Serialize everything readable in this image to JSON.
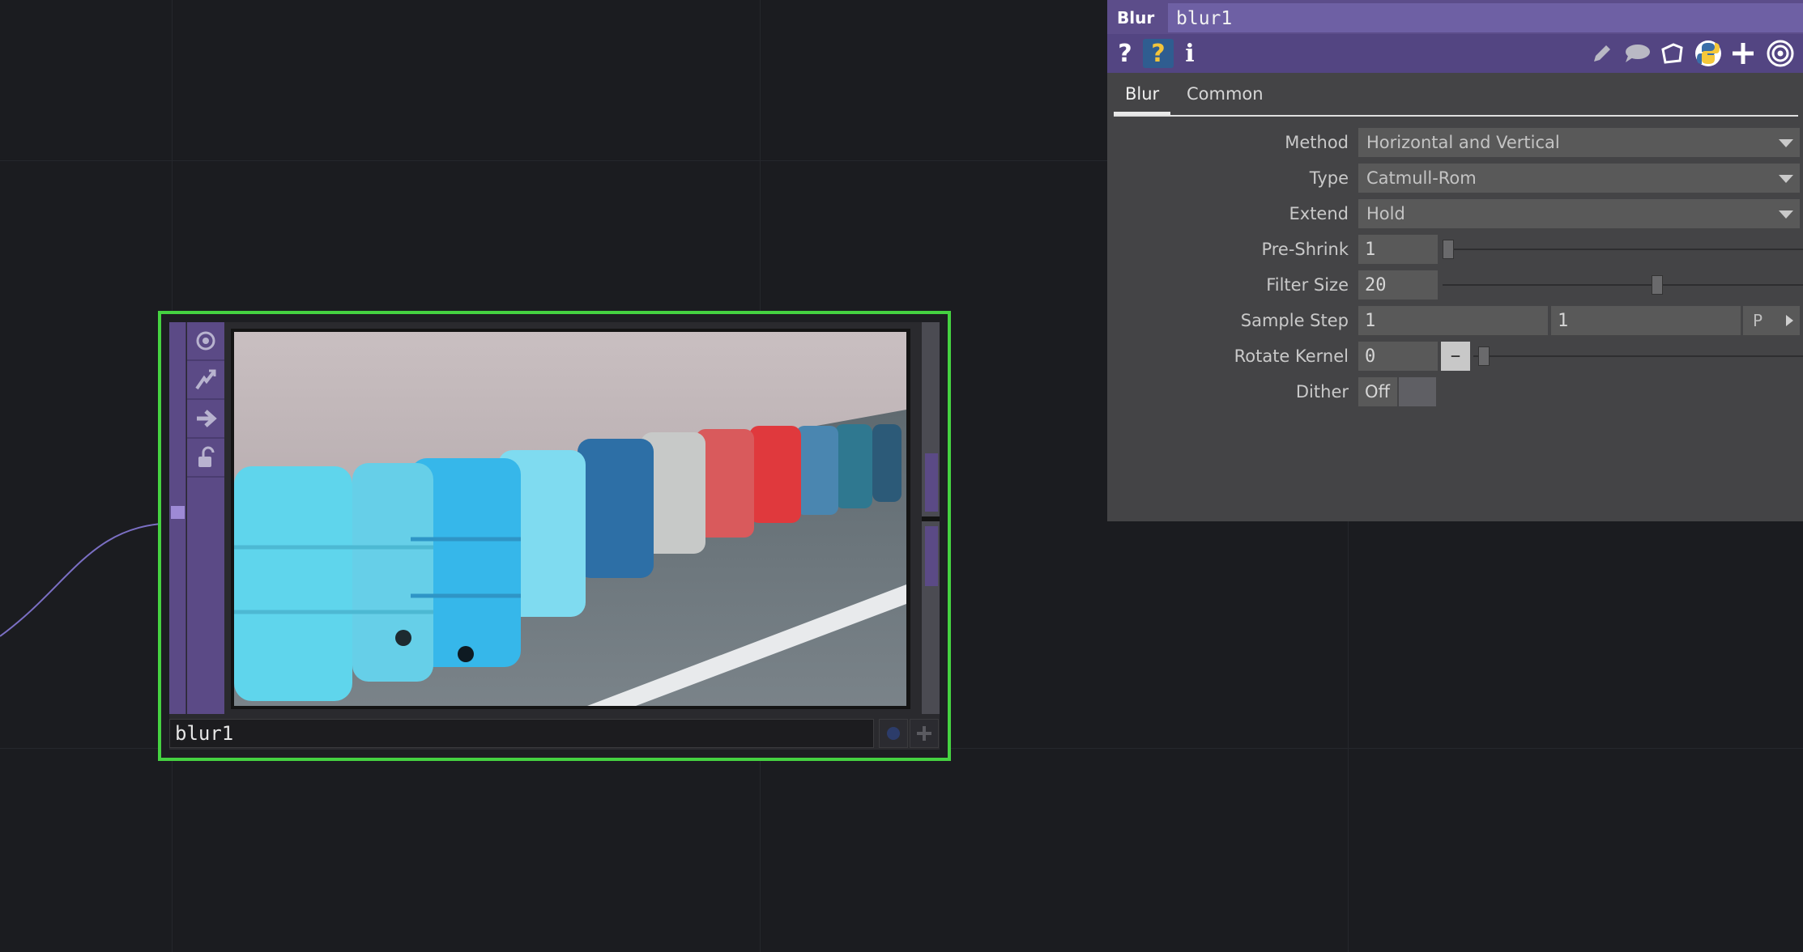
{
  "colors": {
    "background": "#1b1c20",
    "node_border_selected": "#45d241",
    "operator_accent": "#5c4d8a",
    "panel_bg": "#444446",
    "wire": "#7b6fc4"
  },
  "node": {
    "name": "blur1",
    "side_icons": [
      "viewer-icon",
      "bypass-icon",
      "display-icon",
      "lock-icon"
    ],
    "preview_description_icon": "barrels-preview-image"
  },
  "panel": {
    "op_type": "Blur",
    "op_name": "blur1",
    "toolbar": {
      "help_label": "?",
      "python_help_label": "?",
      "info_label": "i"
    },
    "tabs": [
      {
        "label": "Blur",
        "active": true
      },
      {
        "label": "Common",
        "active": false
      }
    ],
    "params": {
      "method": {
        "label": "Method",
        "value": "Horizontal and Vertical"
      },
      "type": {
        "label": "Type",
        "value": "Catmull-Rom"
      },
      "extend": {
        "label": "Extend",
        "value": "Hold"
      },
      "preshrink": {
        "label": "Pre-Shrink",
        "value": "1"
      },
      "filtersize": {
        "label": "Filter Size",
        "value": "20"
      },
      "samplestep": {
        "label": "Sample Step",
        "value1": "1",
        "value2": "1",
        "button": "P"
      },
      "rotatekernel": {
        "label": "Rotate Kernel",
        "value": "0",
        "button": "–"
      },
      "dither": {
        "label": "Dither",
        "value": "Off"
      }
    }
  }
}
